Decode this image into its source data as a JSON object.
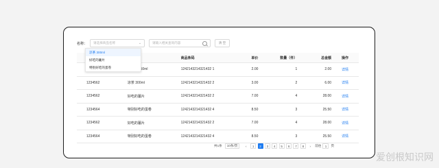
{
  "filter": {
    "label": "名称：",
    "select_placeholder": "请选择商品名称",
    "search_placeholder": "请输入相关查询内容",
    "clear_label": "清 空"
  },
  "dropdown": {
    "options": [
      {
        "label": "凉茶  300ml",
        "active": true
      },
      {
        "label": "好吃的薯片",
        "active": false
      },
      {
        "label": "特别好吃的蛋卷",
        "active": false
      }
    ]
  },
  "table": {
    "headers": [
      "",
      "商品名称",
      "商品条码",
      "单价",
      "数量（件）",
      "总金额",
      "操作"
    ],
    "rows": [
      {
        "id": "",
        "name": "550ml",
        "barcode": "1242143214321432 1",
        "price": "2.00",
        "qty": "1",
        "total": "2.00",
        "action": "详情"
      },
      {
        "id": "1234562",
        "name": "凉茶  300ml",
        "barcode": "1242143214321432 2",
        "price": "3.00",
        "qty": "2",
        "total": "6.00",
        "action": "详情"
      },
      {
        "id": "1234562",
        "name": "好吃的薯片",
        "barcode": "1242143214321432 2",
        "price": "7.00",
        "qty": "4",
        "total": "28.00",
        "action": "详情"
      },
      {
        "id": "1234564",
        "name": "特别好吃的蛋卷",
        "barcode": "1242143214321432 4",
        "price": "8.50",
        "qty": "3",
        "total": "25.50",
        "action": "详情"
      },
      {
        "id": "1234562",
        "name": "好吃的薯片",
        "barcode": "1242143214321432 2",
        "price": "7.00",
        "qty": "4",
        "total": "28.00",
        "action": "详情"
      },
      {
        "id": "1234564",
        "name": "特别好吃的蛋卷",
        "barcode": "1242143214321432 4",
        "price": "8.50",
        "qty": "3",
        "total": "25.50",
        "action": "详情"
      }
    ]
  },
  "pagination": {
    "total_text": "共1条",
    "page_size": "10条/页",
    "prev": "‹",
    "pages": [
      "1",
      "2",
      "3",
      "4",
      "5",
      "6",
      "7",
      "8"
    ],
    "current": "2",
    "next": "›",
    "jump_label": "前往",
    "jump_value": "1",
    "page_unit": "页"
  },
  "watermark": "爱创根知识网"
}
